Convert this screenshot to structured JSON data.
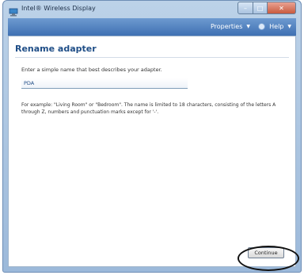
{
  "window": {
    "title": "Intel® Wireless Display",
    "app_icon": "wireless-display-icon"
  },
  "menubar": {
    "properties_label": "Properties",
    "help_label": "Help",
    "help_icon": "help-circle-icon"
  },
  "page": {
    "heading": "Rename adapter",
    "instruction": "Enter a simple name that best describes your adapter.",
    "adapter_name_value": "PDA",
    "example_text": "For example: \"Living Room\" or \"Bedroom\". The name is limited to 18 characters, consisting of the letters A through Z, numbers and punctuation marks except for '-'.",
    "continue_label": "Continue"
  },
  "colors": {
    "heading": "#1f4e87",
    "menubar": "#4a7bbd",
    "close_button": "#c85a3e"
  }
}
